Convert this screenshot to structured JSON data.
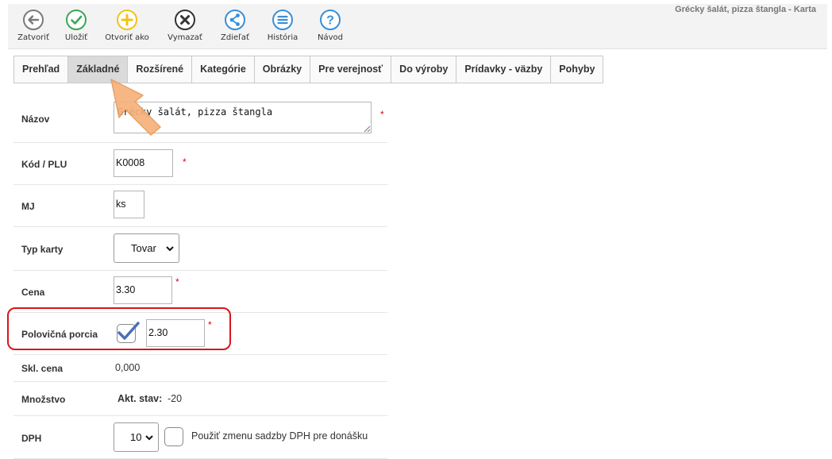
{
  "window": {
    "title": "Grécky šalát, pizza štangla - Karta"
  },
  "toolbar": {
    "close": "Zatvoriť",
    "save": "Uložiť",
    "open_as": "Otvoriť ako",
    "delete": "Vymazať",
    "share": "Zdieľať",
    "history": "História",
    "help": "Návod"
  },
  "tabs": [
    "Prehľad",
    "Základné",
    "Rozšírené",
    "Kategórie",
    "Obrázky",
    "Pre verejnosť",
    "Do výroby",
    "Prídavky - väzby",
    "Pohyby"
  ],
  "active_tab": "Základné",
  "form": {
    "name": {
      "label": "Názov",
      "value": "Grécky šalát, pizza štangla",
      "required": "*"
    },
    "code": {
      "label": "Kód / PLU",
      "value": "K0008",
      "required": "*"
    },
    "unit": {
      "label": "MJ",
      "value": "ks"
    },
    "card_type": {
      "label": "Typ karty",
      "value": "Tovar"
    },
    "price": {
      "label": "Cena",
      "value": "3.30",
      "required": "*"
    },
    "half_portion": {
      "label": "Polovičná porcia",
      "checked": true,
      "value": "2.30",
      "required": "*"
    },
    "stock_price": {
      "label": "Skl. cena",
      "value": "0,000"
    },
    "quantity": {
      "label": "Množstvo",
      "current_label": "Akt. stav:",
      "current_value": "-20"
    },
    "vat": {
      "label": "DPH",
      "value": "10",
      "checkbox_label": "Použiť zmenu sadzby DPH pre donášku",
      "checked": false
    }
  },
  "colors": {
    "close": "#7a7a7a",
    "save": "#3aa655",
    "open": "#f2c316",
    "delete": "#333333",
    "share": "#3a8fd6",
    "history": "#3a8fd6",
    "help": "#3a8fd6",
    "required": "#e2001a",
    "highlight": "#d9141b",
    "arrow": "#f6b17a"
  }
}
